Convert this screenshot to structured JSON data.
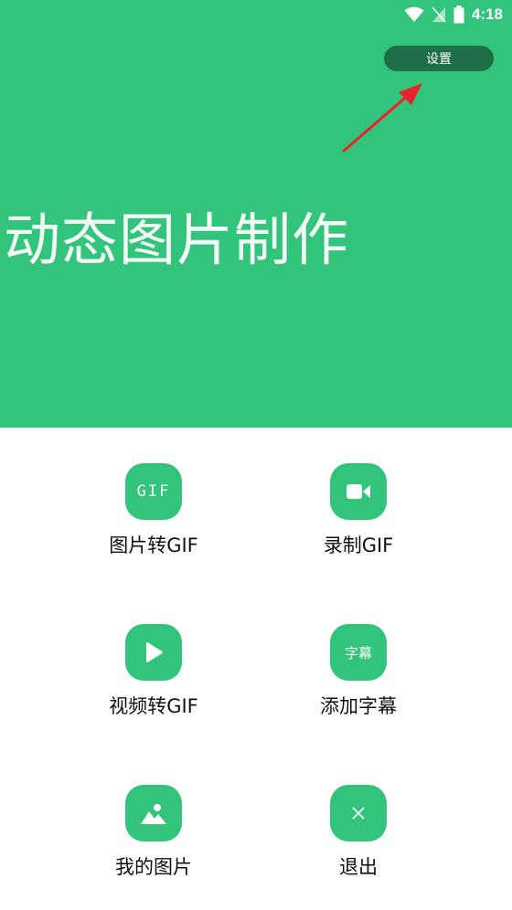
{
  "status_bar": {
    "time": "4:18",
    "icons": [
      "wifi-icon",
      "signal-icon",
      "battery-icon"
    ]
  },
  "header": {
    "settings_label": "设置",
    "title": "动态图片制作"
  },
  "menu": {
    "items": [
      {
        "label": "图片转GIF",
        "icon": "gif-icon",
        "icon_text": "GIF"
      },
      {
        "label": "录制GIF",
        "icon": "video-camera-icon"
      },
      {
        "label": "视频转GIF",
        "icon": "play-icon"
      },
      {
        "label": "添加字幕",
        "icon": "subtitle-icon",
        "icon_text": "字幕"
      },
      {
        "label": "我的图片",
        "icon": "image-icon"
      },
      {
        "label": "退出",
        "icon": "close-icon"
      }
    ]
  },
  "colors": {
    "primary": "#33c47c",
    "settings_button": "#1e6e47",
    "arrow": "#e8232a"
  }
}
